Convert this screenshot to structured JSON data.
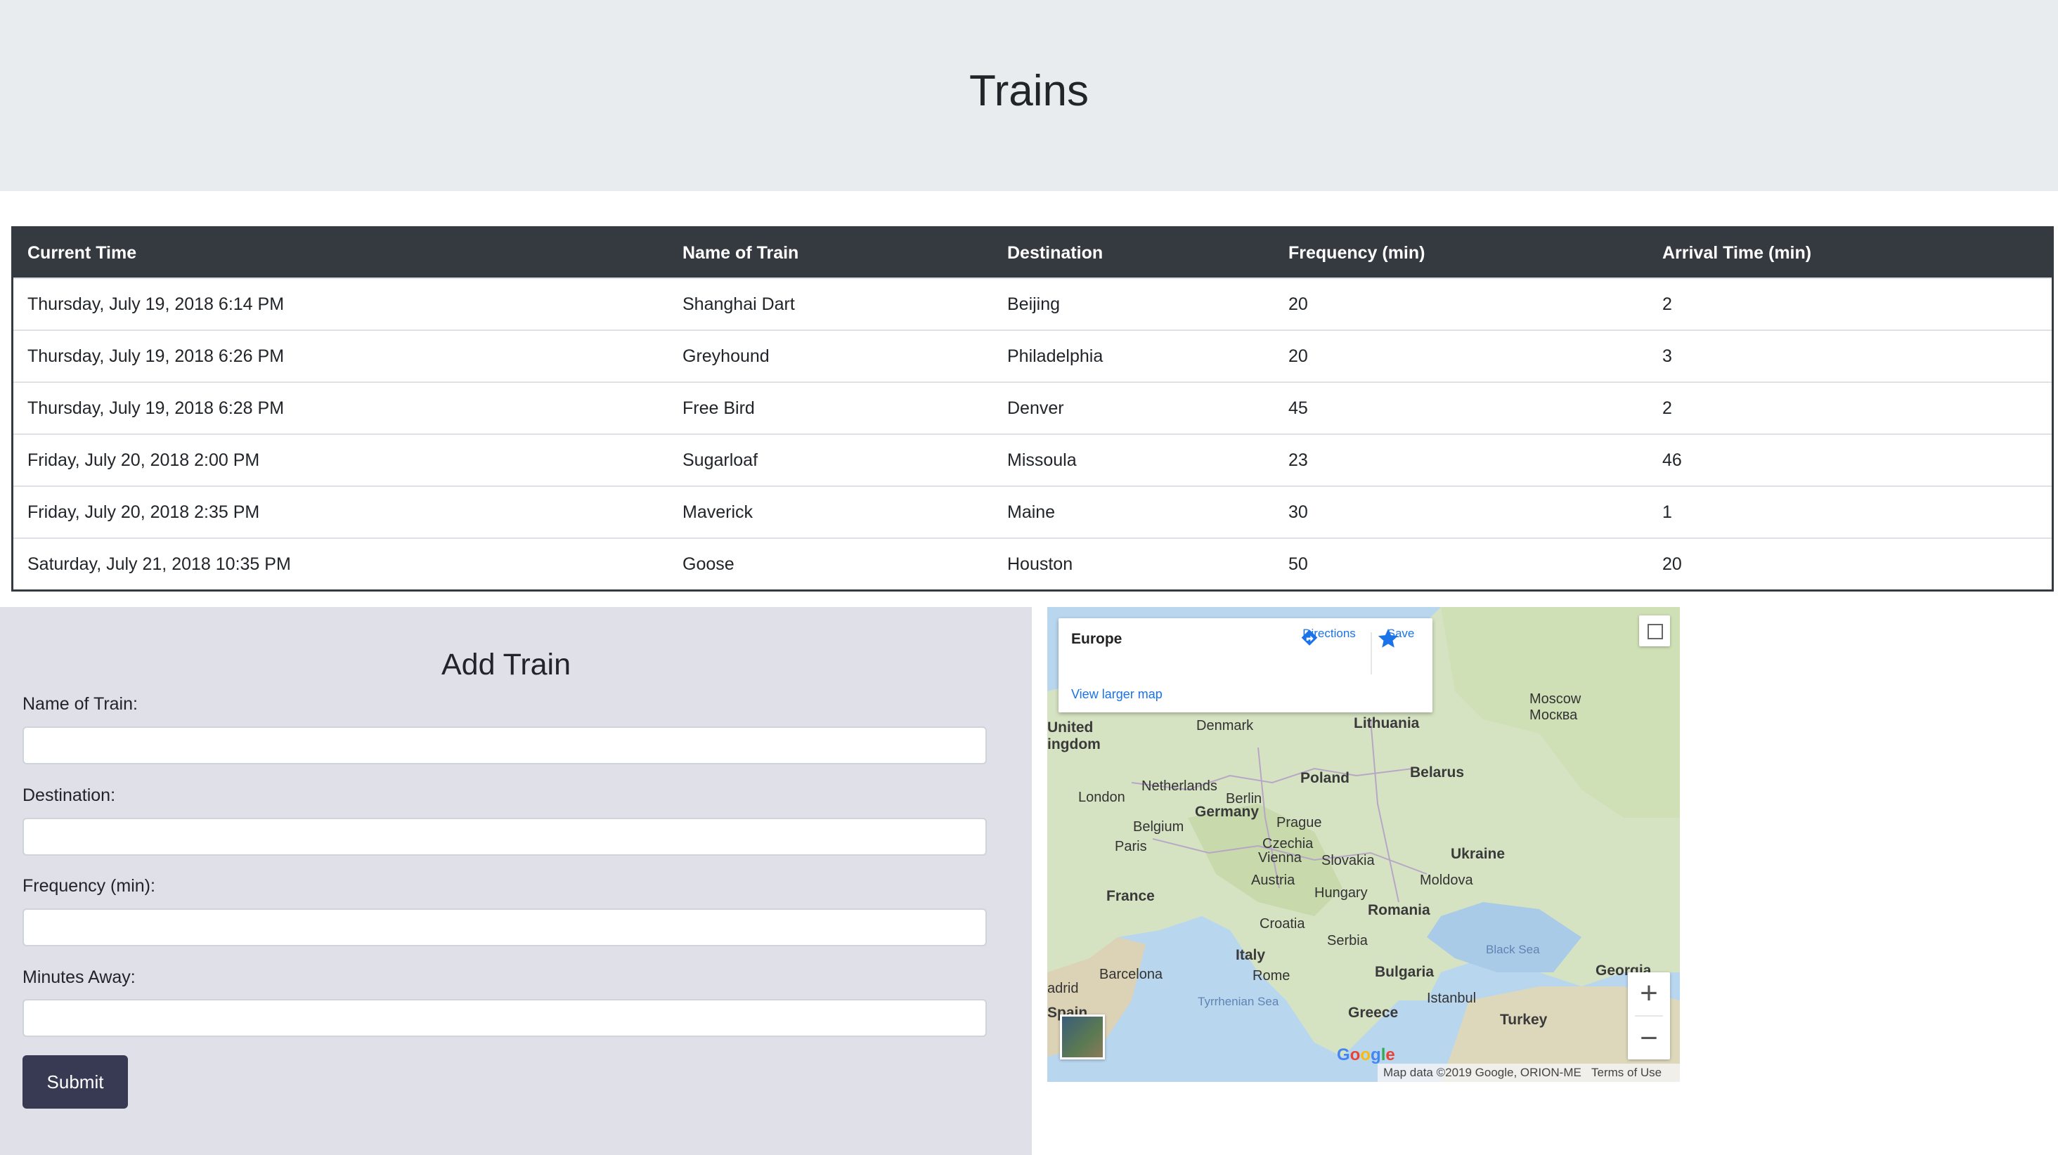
{
  "header": {
    "title": "Trains"
  },
  "table": {
    "headers": [
      "Current Time",
      "Name of Train",
      "Destination",
      "Frequency (min)",
      "Arrival Time (min)"
    ],
    "rows": [
      [
        "Thursday, July 19, 2018 6:14 PM",
        "Shanghai Dart",
        "Beijing",
        "20",
        "2"
      ],
      [
        "Thursday, July 19, 2018 6:26 PM",
        "Greyhound",
        "Philadelphia",
        "20",
        "3"
      ],
      [
        "Thursday, July 19, 2018 6:28 PM",
        "Free Bird",
        "Denver",
        "45",
        "2"
      ],
      [
        "Friday, July 20, 2018 2:00 PM",
        "Sugarloaf",
        "Missoula",
        "23",
        "46"
      ],
      [
        "Friday, July 20, 2018 2:35 PM",
        "Maverick",
        "Maine",
        "30",
        "1"
      ],
      [
        "Saturday, July 21, 2018 10:35 PM",
        "Goose",
        "Houston",
        "50",
        "20"
      ]
    ]
  },
  "form": {
    "title": "Add Train",
    "fields": [
      {
        "label": "Name of Train:",
        "value": ""
      },
      {
        "label": "Destination:",
        "value": ""
      },
      {
        "label": "Frequency (min):",
        "value": ""
      },
      {
        "label": "Minutes Away:",
        "value": ""
      }
    ],
    "submit_label": "Submit"
  },
  "map": {
    "place": "Europe",
    "directions_label": "Directions",
    "save_label": "Save",
    "larger_map_label": "View larger map",
    "attribution": "Map data ©2019 Google, ORION-ME",
    "terms": "Terms of Use",
    "logo": "Google",
    "zoom_in": "+",
    "zoom_out": "−",
    "labels": {
      "uk": "United\ningdom",
      "denmark": "Denmark",
      "lithuania": "Lithuania",
      "moscow": "Moscow\nМосква",
      "netherlands": "Netherlands",
      "london": "London",
      "berlin": "Berlin",
      "poland": "Poland",
      "belarus": "Belarus",
      "belgium": "Belgium",
      "germany": "Germany",
      "prague": "Prague",
      "czechia": "Czechia",
      "paris": "Paris",
      "vienna": "Vienna",
      "slovakia": "Slovakia",
      "ukraine": "Ukraine",
      "austria": "Austria",
      "moldova": "Moldova",
      "hungary": "Hungary",
      "france": "France",
      "romania": "Romania",
      "croatia": "Croatia",
      "serbia": "Serbia",
      "black_sea": "Black Sea",
      "italy": "Italy",
      "barcelona": "Barcelona",
      "rome": "Rome",
      "bulgaria": "Bulgaria",
      "georgia": "Georgia",
      "madrid": "adrid",
      "spain": "Spain",
      "tyrrhenian": "Tyrrhenian Sea",
      "istanbul": "Istanbul",
      "greece": "Greece",
      "turkey": "Turkey"
    }
  }
}
